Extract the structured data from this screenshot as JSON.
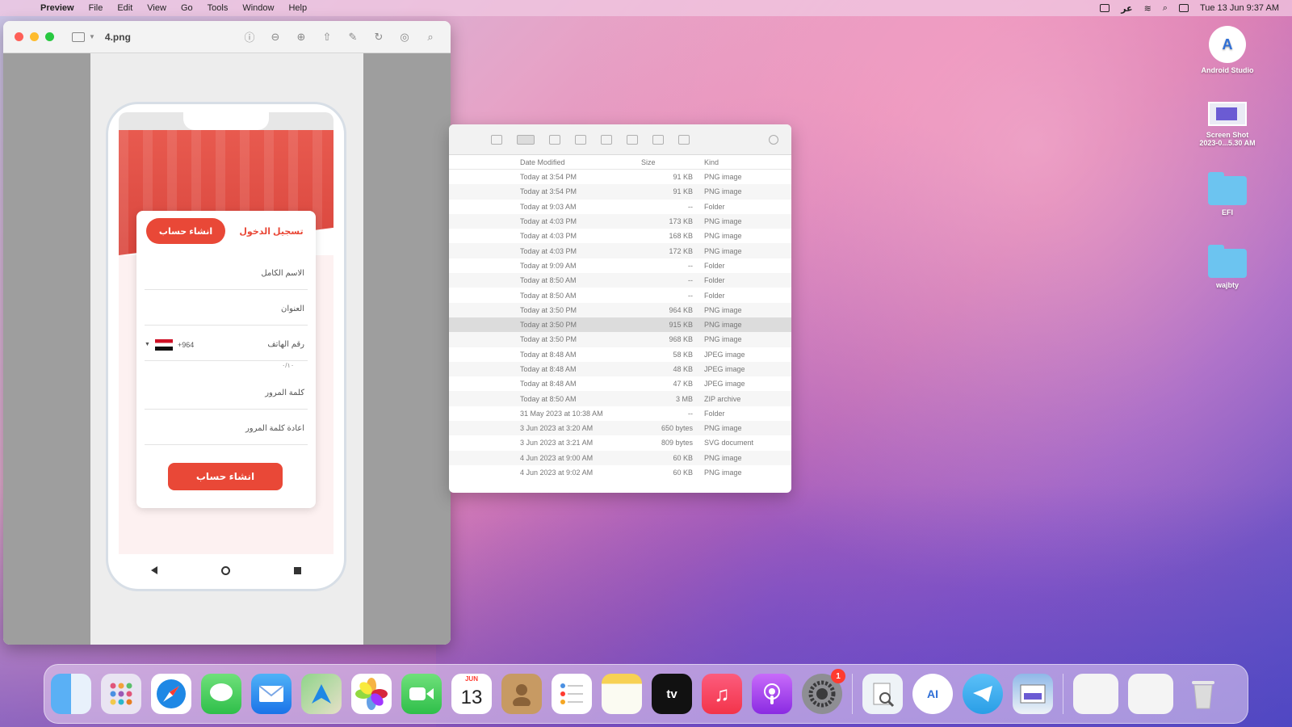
{
  "menubar": {
    "app_name": "Preview",
    "menus": [
      "File",
      "Edit",
      "View",
      "Go",
      "Tools",
      "Window",
      "Help"
    ],
    "input_method": "عر",
    "clock": "Tue 13 Jun 9:37 AM"
  },
  "preview_window": {
    "title": "4.png",
    "signup_tab": "انشاء حساب",
    "login_tab": "تسجيل الدخول",
    "field_fullname": "الاسم الكامل",
    "field_address": "العنوان",
    "field_phone": "رقم الهاتف",
    "country_code": "+964",
    "hint": "٠/١٠",
    "field_password": "كلمة المرور",
    "field_confirm": "اعادة كلمة المرور",
    "submit_label": "انشاء حساب"
  },
  "finder": {
    "columns": {
      "date": "Date Modified",
      "size": "Size",
      "kind": "Kind"
    },
    "rows": [
      {
        "date": "Today at 3:54 PM",
        "size": "91 KB",
        "kind": "PNG image"
      },
      {
        "date": "Today at 3:54 PM",
        "size": "91 KB",
        "kind": "PNG image"
      },
      {
        "date": "Today at 9:03 AM",
        "size": "--",
        "kind": "Folder"
      },
      {
        "date": "Today at 4:03 PM",
        "size": "173 KB",
        "kind": "PNG image"
      },
      {
        "date": "Today at 4:03 PM",
        "size": "168 KB",
        "kind": "PNG image"
      },
      {
        "date": "Today at 4:03 PM",
        "size": "172 KB",
        "kind": "PNG image"
      },
      {
        "date": "Today at 9:09 AM",
        "size": "--",
        "kind": "Folder"
      },
      {
        "date": "Today at 8:50 AM",
        "size": "--",
        "kind": "Folder"
      },
      {
        "date": "Today at 8:50 AM",
        "size": "--",
        "kind": "Folder"
      },
      {
        "date": "Today at 3:50 PM",
        "size": "964 KB",
        "kind": "PNG image"
      },
      {
        "date": "Today at 3:50 PM",
        "size": "915 KB",
        "kind": "PNG image"
      },
      {
        "date": "Today at 3:50 PM",
        "size": "968 KB",
        "kind": "PNG image"
      },
      {
        "date": "Today at 8:48 AM",
        "size": "58 KB",
        "kind": "JPEG image"
      },
      {
        "date": "Today at 8:48 AM",
        "size": "48 KB",
        "kind": "JPEG image"
      },
      {
        "date": "Today at 8:48 AM",
        "size": "47 KB",
        "kind": "JPEG image"
      },
      {
        "date": "Today at 8:50 AM",
        "size": "3 MB",
        "kind": "ZIP archive"
      },
      {
        "date": "31 May 2023 at 10:38 AM",
        "size": "--",
        "kind": "Folder"
      },
      {
        "date": "3 Jun 2023 at 3:20 AM",
        "size": "650 bytes",
        "kind": "PNG image"
      },
      {
        "date": "3 Jun 2023 at 3:21 AM",
        "size": "809 bytes",
        "kind": "SVG document"
      },
      {
        "date": "4 Jun 2023 at 9:00 AM",
        "size": "60 KB",
        "kind": "PNG image"
      },
      {
        "date": "4 Jun 2023 at 9:02 AM",
        "size": "60 KB",
        "kind": "PNG image"
      }
    ]
  },
  "desktop": {
    "icons": [
      "Android Studio",
      "Screen Shot",
      "2023-0...5.30 AM",
      "EFI",
      "wajbty"
    ]
  },
  "dock": {
    "calendar_month": "JUN",
    "calendar_day": "13",
    "tv_label": "tv",
    "settings_badge": "1",
    "android_glyph": "AI"
  },
  "colors": {
    "accent_red": "#e94837",
    "wallpaper_pink": "#e57fb0",
    "wallpaper_violet": "#5b55c8"
  }
}
